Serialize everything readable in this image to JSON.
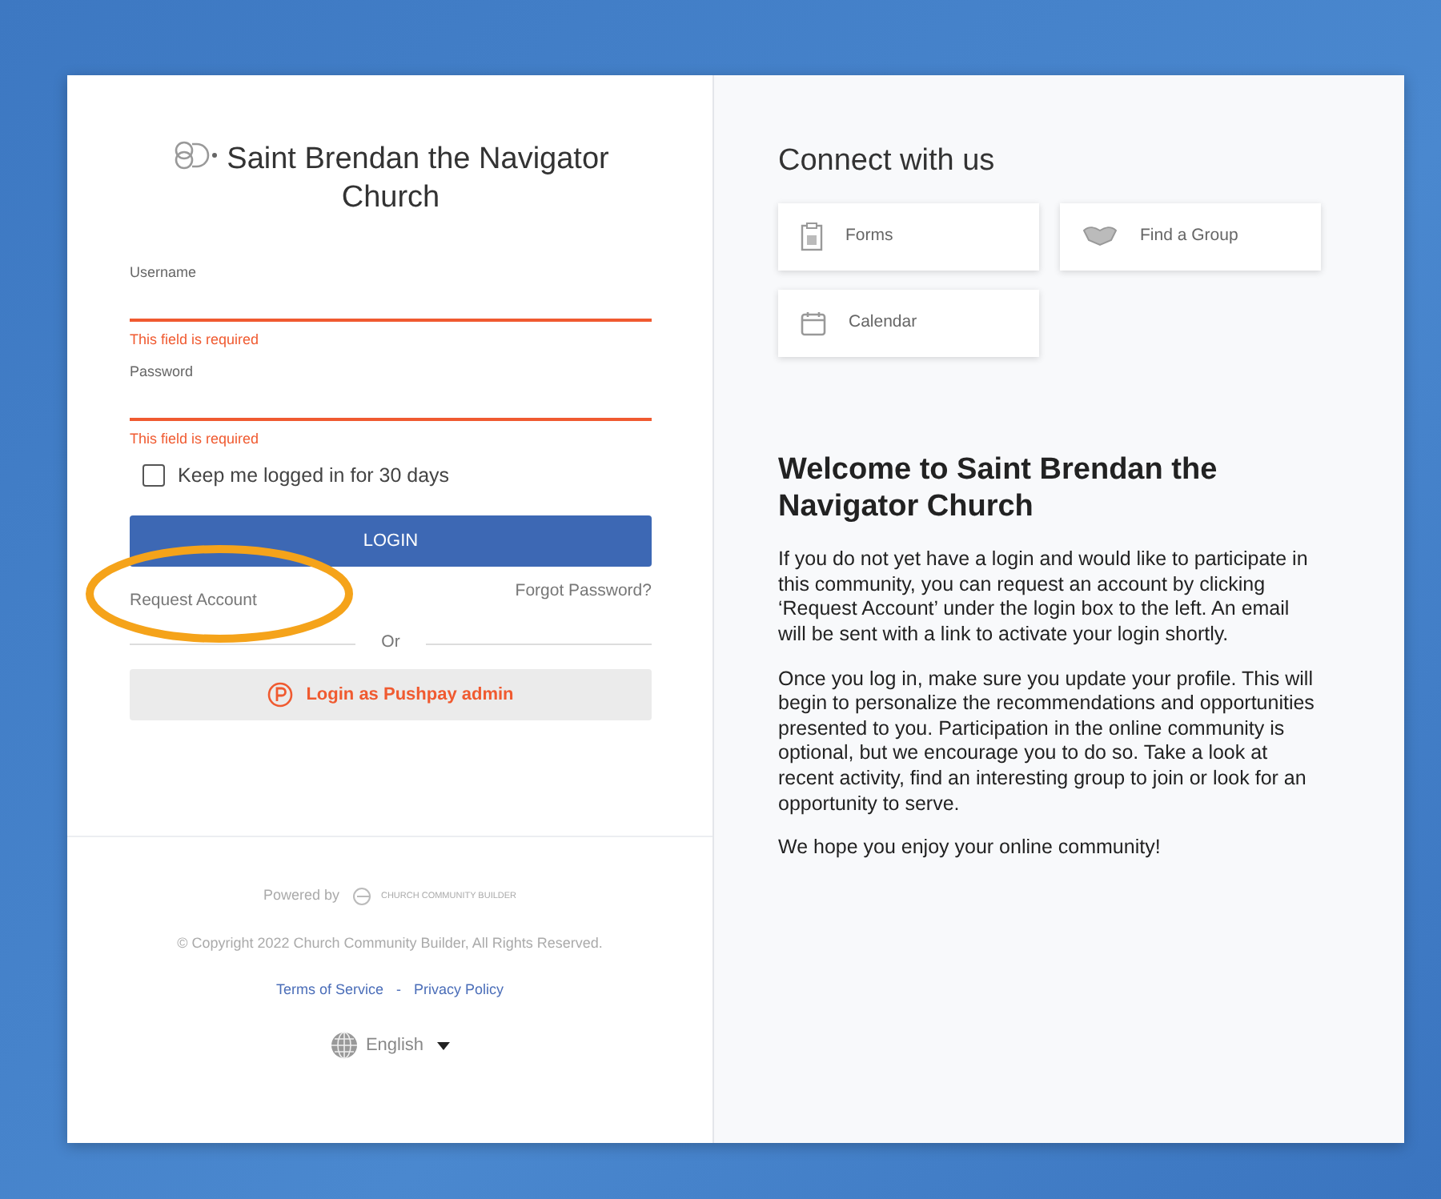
{
  "login": {
    "church_name": "Saint Brendan the Navigator Church",
    "fields": [
      {
        "label": "Username",
        "error": "This field is required",
        "invalid": true
      },
      {
        "label": "Password",
        "error": "This field is required",
        "invalid": true
      }
    ],
    "remember": {
      "label": "Keep me logged in for 30 days",
      "checked": false
    },
    "login_button": "LOGIN",
    "request_account": {
      "text": "Request Account",
      "highlighted": true
    },
    "forgot_password": "Forgot Password?",
    "divider": "Or",
    "pushpay_button": "Login as Pushpay admin"
  },
  "footer": {
    "powered_by": "Powered by",
    "builder_logo": "CHURCH COMMUNITY BUILDER",
    "copyright": "© Copyright 2022 Church Community Builder, All Rights Reserved.",
    "links": [
      "Terms of Service",
      "Privacy Policy"
    ],
    "separator": "-",
    "language": "English"
  },
  "connect": {
    "title": "Connect with us",
    "tiles": [
      {
        "kind": "forms",
        "label": "Forms"
      },
      {
        "kind": "group",
        "label": "Find a Group"
      },
      {
        "kind": "calendar",
        "label": "Calendar"
      }
    ]
  },
  "welcome": {
    "title": "Welcome to Saint Brendan the Navigator Church",
    "paragraphs": [
      "If you do not yet have a login and would like to participate in this community, you can request an account by clicking ‘Request Account’ under the login box to the left. An email will be sent with a link to activate your login shortly.",
      "Once you log in, make sure you update your profile. This will begin to personalize the recommendations and opportunities presented to you. Participation in the online community is optional, but we encourage you to do so. Take a look at recent activity, find an interesting group to join or look for an opportunity to serve.",
      "We hope you enjoy your online community!"
    ]
  }
}
